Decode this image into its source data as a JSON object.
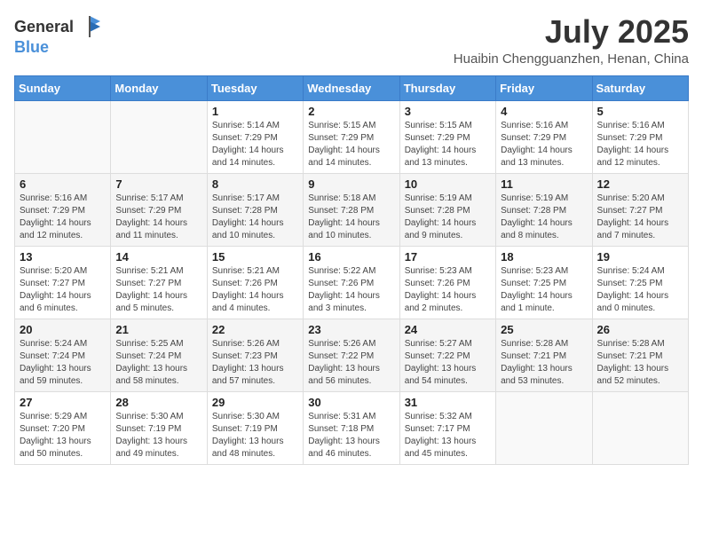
{
  "header": {
    "logo_general": "General",
    "logo_blue": "Blue",
    "month": "July 2025",
    "location": "Huaibin Chengguanzhen, Henan, China"
  },
  "weekdays": [
    "Sunday",
    "Monday",
    "Tuesday",
    "Wednesday",
    "Thursday",
    "Friday",
    "Saturday"
  ],
  "weeks": [
    [
      {
        "day": "",
        "info": ""
      },
      {
        "day": "",
        "info": ""
      },
      {
        "day": "1",
        "info": "Sunrise: 5:14 AM\nSunset: 7:29 PM\nDaylight: 14 hours\nand 14 minutes."
      },
      {
        "day": "2",
        "info": "Sunrise: 5:15 AM\nSunset: 7:29 PM\nDaylight: 14 hours\nand 14 minutes."
      },
      {
        "day": "3",
        "info": "Sunrise: 5:15 AM\nSunset: 7:29 PM\nDaylight: 14 hours\nand 13 minutes."
      },
      {
        "day": "4",
        "info": "Sunrise: 5:16 AM\nSunset: 7:29 PM\nDaylight: 14 hours\nand 13 minutes."
      },
      {
        "day": "5",
        "info": "Sunrise: 5:16 AM\nSunset: 7:29 PM\nDaylight: 14 hours\nand 12 minutes."
      }
    ],
    [
      {
        "day": "6",
        "info": "Sunrise: 5:16 AM\nSunset: 7:29 PM\nDaylight: 14 hours\nand 12 minutes."
      },
      {
        "day": "7",
        "info": "Sunrise: 5:17 AM\nSunset: 7:29 PM\nDaylight: 14 hours\nand 11 minutes."
      },
      {
        "day": "8",
        "info": "Sunrise: 5:17 AM\nSunset: 7:28 PM\nDaylight: 14 hours\nand 10 minutes."
      },
      {
        "day": "9",
        "info": "Sunrise: 5:18 AM\nSunset: 7:28 PM\nDaylight: 14 hours\nand 10 minutes."
      },
      {
        "day": "10",
        "info": "Sunrise: 5:19 AM\nSunset: 7:28 PM\nDaylight: 14 hours\nand 9 minutes."
      },
      {
        "day": "11",
        "info": "Sunrise: 5:19 AM\nSunset: 7:28 PM\nDaylight: 14 hours\nand 8 minutes."
      },
      {
        "day": "12",
        "info": "Sunrise: 5:20 AM\nSunset: 7:27 PM\nDaylight: 14 hours\nand 7 minutes."
      }
    ],
    [
      {
        "day": "13",
        "info": "Sunrise: 5:20 AM\nSunset: 7:27 PM\nDaylight: 14 hours\nand 6 minutes."
      },
      {
        "day": "14",
        "info": "Sunrise: 5:21 AM\nSunset: 7:27 PM\nDaylight: 14 hours\nand 5 minutes."
      },
      {
        "day": "15",
        "info": "Sunrise: 5:21 AM\nSunset: 7:26 PM\nDaylight: 14 hours\nand 4 minutes."
      },
      {
        "day": "16",
        "info": "Sunrise: 5:22 AM\nSunset: 7:26 PM\nDaylight: 14 hours\nand 3 minutes."
      },
      {
        "day": "17",
        "info": "Sunrise: 5:23 AM\nSunset: 7:26 PM\nDaylight: 14 hours\nand 2 minutes."
      },
      {
        "day": "18",
        "info": "Sunrise: 5:23 AM\nSunset: 7:25 PM\nDaylight: 14 hours\nand 1 minute."
      },
      {
        "day": "19",
        "info": "Sunrise: 5:24 AM\nSunset: 7:25 PM\nDaylight: 14 hours\nand 0 minutes."
      }
    ],
    [
      {
        "day": "20",
        "info": "Sunrise: 5:24 AM\nSunset: 7:24 PM\nDaylight: 13 hours\nand 59 minutes."
      },
      {
        "day": "21",
        "info": "Sunrise: 5:25 AM\nSunset: 7:24 PM\nDaylight: 13 hours\nand 58 minutes."
      },
      {
        "day": "22",
        "info": "Sunrise: 5:26 AM\nSunset: 7:23 PM\nDaylight: 13 hours\nand 57 minutes."
      },
      {
        "day": "23",
        "info": "Sunrise: 5:26 AM\nSunset: 7:22 PM\nDaylight: 13 hours\nand 56 minutes."
      },
      {
        "day": "24",
        "info": "Sunrise: 5:27 AM\nSunset: 7:22 PM\nDaylight: 13 hours\nand 54 minutes."
      },
      {
        "day": "25",
        "info": "Sunrise: 5:28 AM\nSunset: 7:21 PM\nDaylight: 13 hours\nand 53 minutes."
      },
      {
        "day": "26",
        "info": "Sunrise: 5:28 AM\nSunset: 7:21 PM\nDaylight: 13 hours\nand 52 minutes."
      }
    ],
    [
      {
        "day": "27",
        "info": "Sunrise: 5:29 AM\nSunset: 7:20 PM\nDaylight: 13 hours\nand 50 minutes."
      },
      {
        "day": "28",
        "info": "Sunrise: 5:30 AM\nSunset: 7:19 PM\nDaylight: 13 hours\nand 49 minutes."
      },
      {
        "day": "29",
        "info": "Sunrise: 5:30 AM\nSunset: 7:19 PM\nDaylight: 13 hours\nand 48 minutes."
      },
      {
        "day": "30",
        "info": "Sunrise: 5:31 AM\nSunset: 7:18 PM\nDaylight: 13 hours\nand 46 minutes."
      },
      {
        "day": "31",
        "info": "Sunrise: 5:32 AM\nSunset: 7:17 PM\nDaylight: 13 hours\nand 45 minutes."
      },
      {
        "day": "",
        "info": ""
      },
      {
        "day": "",
        "info": ""
      }
    ]
  ]
}
